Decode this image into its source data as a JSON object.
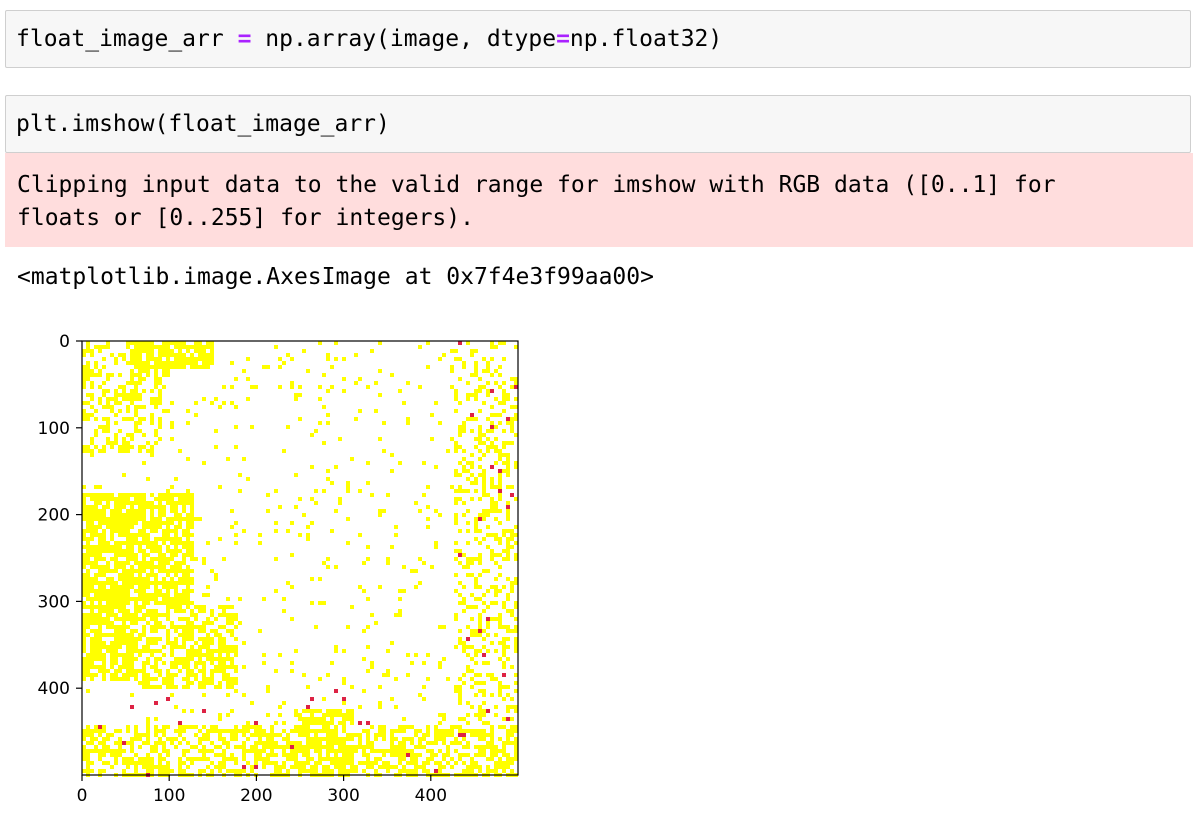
{
  "cells": [
    {
      "code_parts": [
        {
          "text": "float_image_arr ",
          "kind": "code"
        },
        {
          "text": "=",
          "kind": "op"
        },
        {
          "text": " np.array(image, dtype",
          "kind": "code"
        },
        {
          "text": "=",
          "kind": "op"
        },
        {
          "text": "np.float32)",
          "kind": "code"
        }
      ]
    },
    {
      "code": "plt.imshow(float_image_arr)",
      "stderr": "Clipping input data to the valid range for imshow with RGB data ([0..1] for\nfloats or [0..255] for integers).",
      "output_repr": "<matplotlib.image.AxesImage at 0x7f4e3f99aa00>"
    }
  ],
  "colors": {
    "input_bg": "#f7f7f7",
    "stderr_bg": "#ffdddd",
    "operator": "#aa22ff",
    "image_main": "#ffff00",
    "image_bg": "#ffffff",
    "image_accent": "#dd2244"
  },
  "chart_data": {
    "type": "heatmap",
    "title": "",
    "xlabel": "",
    "ylabel": "",
    "xlim": [
      0,
      500
    ],
    "ylim": [
      500,
      0
    ],
    "xticks": [
      0,
      100,
      200,
      300,
      400
    ],
    "yticks": [
      0,
      100,
      200,
      300,
      400
    ],
    "description_colors": [
      "yellow",
      "white",
      "red"
    ]
  }
}
